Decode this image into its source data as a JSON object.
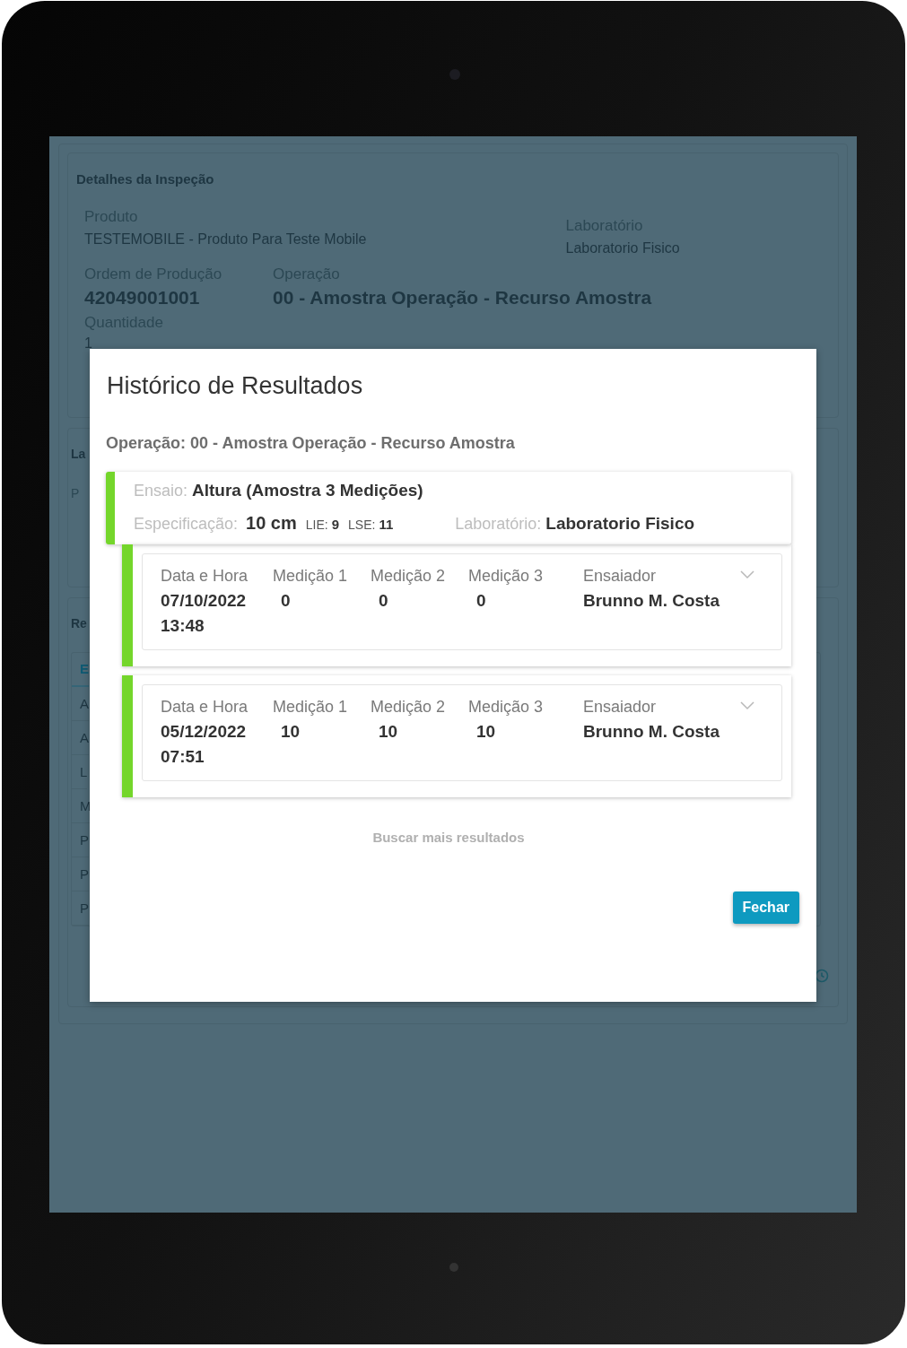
{
  "background": {
    "details": {
      "title": "Detalhes da Inspeção",
      "fields": [
        {
          "label": "Produto",
          "value": "TESTEMOBILE - Produto Para Teste Mobile"
        },
        {
          "label": "Laboratório",
          "value": "Laboratorio Fisico"
        },
        {
          "label": "Ordem de Produção",
          "value": "42049001001"
        },
        {
          "label": "Operação",
          "value": "00 - Amostra Operação - Recurso Amostra"
        },
        {
          "label": "Quantidade",
          "value": "1"
        }
      ]
    },
    "lab_section": {
      "title": "La",
      "rows": [
        "P"
      ]
    },
    "results_section": {
      "title": "Re",
      "header": "E",
      "rows": [
        "A",
        "A",
        "L",
        "M",
        "P",
        "P",
        "P"
      ]
    }
  },
  "modal": {
    "title": "Histórico de Resultados",
    "operation": "Operação: 00 - Amostra Operação - Recurso Amostra",
    "test": {
      "test_label": "Ensaio:",
      "test_value": "Altura (Amostra 3 Medições)",
      "spec_label": "Especificação:",
      "spec_value": "10 cm",
      "lie_label": "LIE:",
      "lie_value": "9",
      "lse_label": "LSE:",
      "lse_value": "11",
      "lab_label": "Laboratório:",
      "lab_value": "Laboratorio Fisico"
    },
    "results": [
      {
        "date_label": "Data e Hora",
        "date": "07/10/2022 13:48",
        "measurements": [
          {
            "label": "Medição 1",
            "value": "0"
          },
          {
            "label": "Medição 2",
            "value": "0"
          },
          {
            "label": "Medição 3",
            "value": "0"
          }
        ],
        "tester_label": "Ensaiador",
        "tester": "Brunno M. Costa",
        "expanded": false
      },
      {
        "date_label": "Data e Hora",
        "date": "05/12/2022 07:51",
        "measurements": [
          {
            "label": "Medição 1",
            "value": "10"
          },
          {
            "label": "Medição 2",
            "value": "10"
          },
          {
            "label": "Medição 3",
            "value": "10"
          }
        ],
        "tester_label": "Ensaiador",
        "tester": "Brunno M. Costa",
        "expanded": false
      }
    ],
    "load_more": "Buscar mais resultados",
    "close_button": "Fechar"
  }
}
